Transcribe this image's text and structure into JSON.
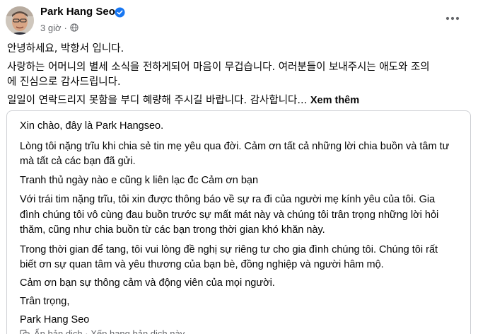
{
  "post": {
    "author": "Park Hang Seo",
    "time": "3 giờ",
    "separator": "·",
    "korean_lines": [
      "안녕하세요, 박항서 입니다.",
      "사랑하는 어머니의 별세 소식을 전하게되어 마음이 무겁습니다. 여러분들이 보내주시는 애도와 조의",
      "에 진심으로 감사드립니다.",
      "일일이 연락드리지 못함을 부디 혜량해 주시길 바랍니다. 감사합니다..."
    ],
    "see_more": "Xem thêm"
  },
  "translation": {
    "lines": [
      "Xin chào, đây là Park Hangseo.",
      "Lòng tôi nặng trĩu khi chia sẻ tin mẹ yêu qua đời. Cảm ơn tất cả những lời chia buồn và tâm tư",
      "mà tất cả các bạn đã gửi.",
      "Tranh thủ ngày nào e cũng k liên lạc đc Cảm ơn bạn",
      "Với trái tim nặng trĩu, tôi xin được thông báo về sự ra đi của người mẹ kính yêu của tôi. Gia",
      "đình chúng tôi vô cùng đau buồn trước sự mất mát này và chúng tôi trân trọng những lời hỏi",
      "thăm, cũng như chia buồn từ các bạn trong thời gian khó khăn này.",
      "Trong thời gian để tang, tôi vui lòng đề nghị sự riêng tư cho gia đình chúng tôi. Chúng tôi rất",
      "biết ơn sự quan tâm và yêu thương của bạn bè, đồng nghiệp và người hâm mộ.",
      "Cảm ơn bạn sự thông cảm và động viên của mọi người.",
      "Trân trọng,",
      "Park Hang Seo"
    ],
    "footer_partial": "Ẩn bản dịch · Xếp hạng bản dịch này"
  },
  "colors": {
    "text": "#050505",
    "secondary": "#65676b",
    "verified": "#1877f2",
    "border": "#ced0d4"
  },
  "icons": {
    "verified": "verified-badge-icon",
    "privacy": "globe-icon",
    "more": "more-horizontal-icon",
    "rating": "translate-icon"
  }
}
